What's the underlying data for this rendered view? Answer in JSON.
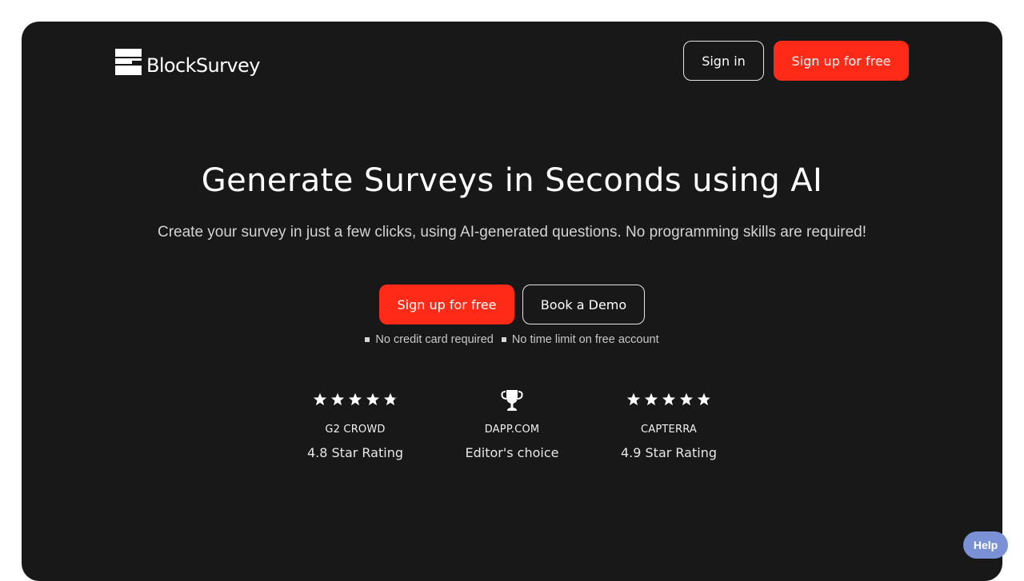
{
  "brand": {
    "name": "BlockSurvey",
    "logo_icon": "blocksurvey-logo-icon"
  },
  "nav": {
    "signin_label": "Sign in",
    "signup_label": "Sign up for free"
  },
  "hero": {
    "title": "Generate Surveys in Seconds using AI",
    "subtitle": "Create your survey in just a few clicks, using AI-generated questions. No programming skills are required!",
    "primary_cta": "Sign up for free",
    "secondary_cta": "Book a Demo",
    "perks": [
      "No credit card required",
      "No time limit on free account"
    ]
  },
  "ratings": [
    {
      "icon": "five-star-icon",
      "stars": 4.8,
      "max_stars": 5,
      "source": "G2 CROWD",
      "label": "4.8 Star Rating"
    },
    {
      "icon": "trophy-icon",
      "source": "DAPP.COM",
      "label": "Editor's choice"
    },
    {
      "icon": "five-star-icon",
      "stars": 4.9,
      "max_stars": 5,
      "source": "CAPTERRA",
      "label": "4.9 Star Rating"
    }
  ],
  "help": {
    "label": "Help"
  },
  "colors": {
    "accent": "#ff2a17",
    "background": "#181818",
    "help": "#7b91d6"
  }
}
